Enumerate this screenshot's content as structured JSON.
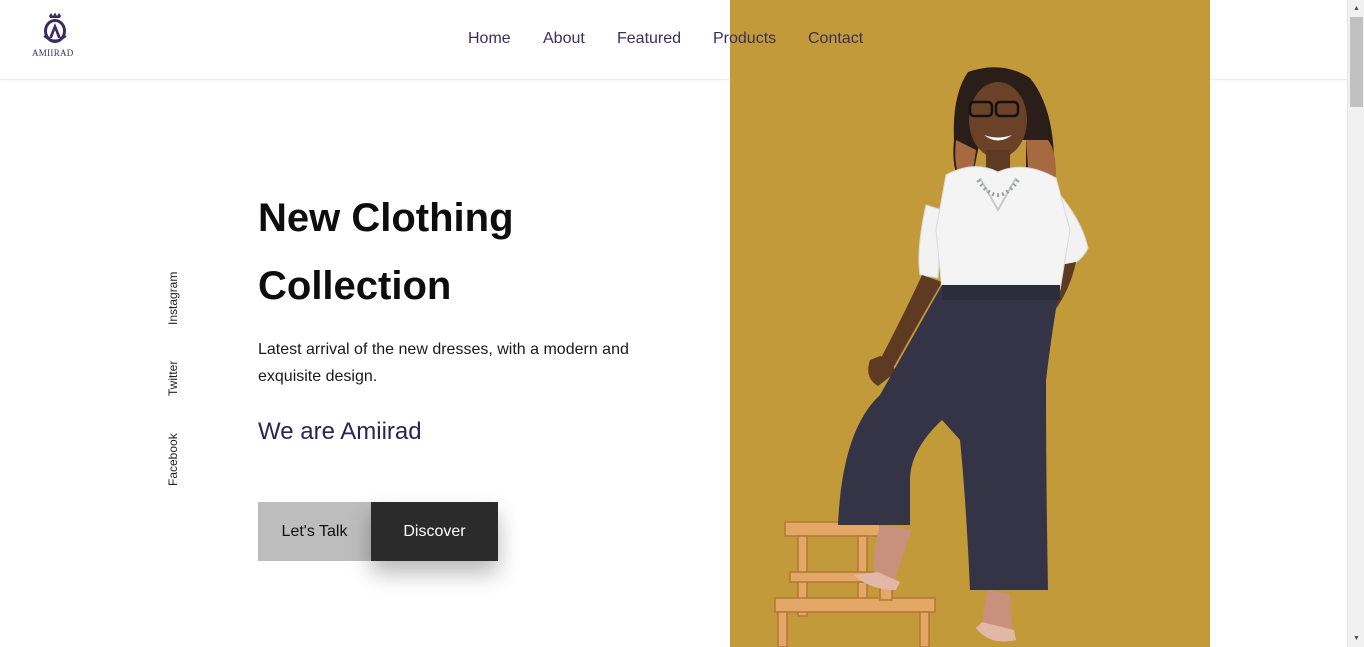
{
  "brand": {
    "name": "AMIIRAD",
    "logo_icon": "crest-logo-icon",
    "color": "#3b2c5e"
  },
  "nav": {
    "items": [
      {
        "label": "Home"
      },
      {
        "label": "About"
      },
      {
        "label": "Featured"
      },
      {
        "label": "Products"
      },
      {
        "label": "Contact"
      }
    ]
  },
  "social": {
    "instagram": "Instagram",
    "twitter": "Twitter",
    "facebook": "Facebook"
  },
  "hero": {
    "title_line1": "New Clothing",
    "title_line2": "Collection",
    "description": "Latest arrival of the new dresses, with a modern and exquisite design.",
    "tagline": "We are Amiirad",
    "cta_primary": "Let's Talk",
    "cta_secondary": "Discover",
    "image_background": "#c29a39",
    "image_subject": "model-photo"
  },
  "colors": {
    "accent": "#2b2457",
    "nav_text": "#3a2f5b",
    "dark_button": "#2b2b2b",
    "light_button": "#bdbdbd"
  }
}
